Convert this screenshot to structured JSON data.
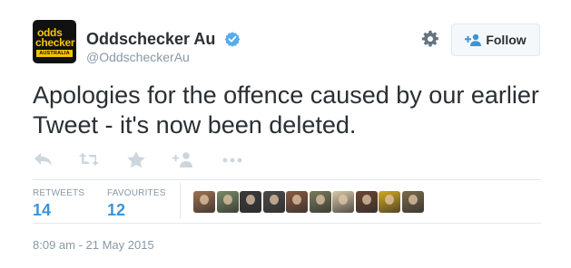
{
  "account": {
    "display_name": "Oddschecker Au",
    "username": "@OddscheckerAu",
    "avatar_line1": "odds",
    "avatar_line2": "checker",
    "avatar_line3": "AUSTRALIA",
    "verified": true
  },
  "follow_button": {
    "label": "Follow"
  },
  "tweet": {
    "text": "Apologies for the offence caused by our earlier Tweet - it's now been deleted."
  },
  "actions": [
    {
      "icon": "reply-icon"
    },
    {
      "icon": "retweet-icon"
    },
    {
      "icon": "favourite-icon"
    },
    {
      "icon": "add-to-list-icon"
    },
    {
      "icon": "more-icon"
    }
  ],
  "stats": {
    "retweets_label": "RETWEETS",
    "retweets_count": "14",
    "favourites_label": "FAVOURITES",
    "favourites_count": "12"
  },
  "favouriters": [
    {
      "color": "#a07050"
    },
    {
      "color": "#7a8a66"
    },
    {
      "color": "#3a3a3a"
    },
    {
      "color": "#4a4a4a"
    },
    {
      "color": "#8a5a40"
    },
    {
      "color": "#7a7a5a"
    },
    {
      "color": "#d8c8a8"
    },
    {
      "color": "#6a4630"
    },
    {
      "color": "#d4a820"
    },
    {
      "color": "#7a6a4a"
    }
  ],
  "timestamp": "8:09 am - 21 May 2015",
  "colors": {
    "link_blue": "#3b94d9",
    "text": "#292f33",
    "muted": "#8899a6",
    "verified_blue": "#55acee",
    "brand_yellow": "#f2c500"
  }
}
